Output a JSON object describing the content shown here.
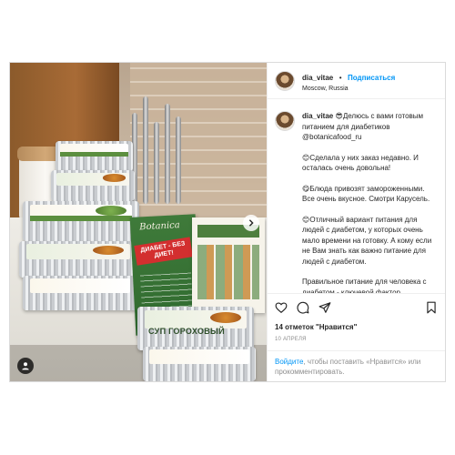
{
  "post": {
    "username": "dia_vitae",
    "follow_label": "Подписаться",
    "separator": "•",
    "location": "Moscow, Russia",
    "caption": {
      "username": "dia_vitae",
      "first_line": "😎Делюсь с вами готовым питанием для диабетиков @botanicafood_ru",
      "paragraphs": [
        "😊Сделала у них заказ недавно. И осталась очень довольна!",
        "😋Блюда привозят замороженными. Все очень вкусное. Смотри Карусель.",
        "😊Отличный вариант питания для людей с диабетом, у которых очень мало времени на готовку. А кому если не Вам знать как важно питание для людей с диабетом.",
        "Правильное питание для человека с диабетом - ключевой фактор, определяющий продолжительность и"
      ]
    },
    "likes_text": "14 отметок \"Нравится\"",
    "date": "10 АПРЕЛЯ",
    "login_prompt": {
      "link": "Войдите",
      "rest": ", чтобы поставить «Нравится» или прокомментировать."
    },
    "icons": [
      "heart-icon",
      "comment-icon",
      "share-icon",
      "bookmark-icon",
      "carousel-next-icon",
      "user-tag-icon"
    ]
  },
  "photo": {
    "flyer_brand": "Botanica",
    "flyer_badge": "ДИАБЕТ - БЕЗ ДИЕТ!",
    "soup_label": "СУП ГОРОХОВЫЙ"
  },
  "colors": {
    "accent": "#0095f6",
    "text": "#262626",
    "muted": "#8e8e8e",
    "border": "#dbdbdb"
  }
}
